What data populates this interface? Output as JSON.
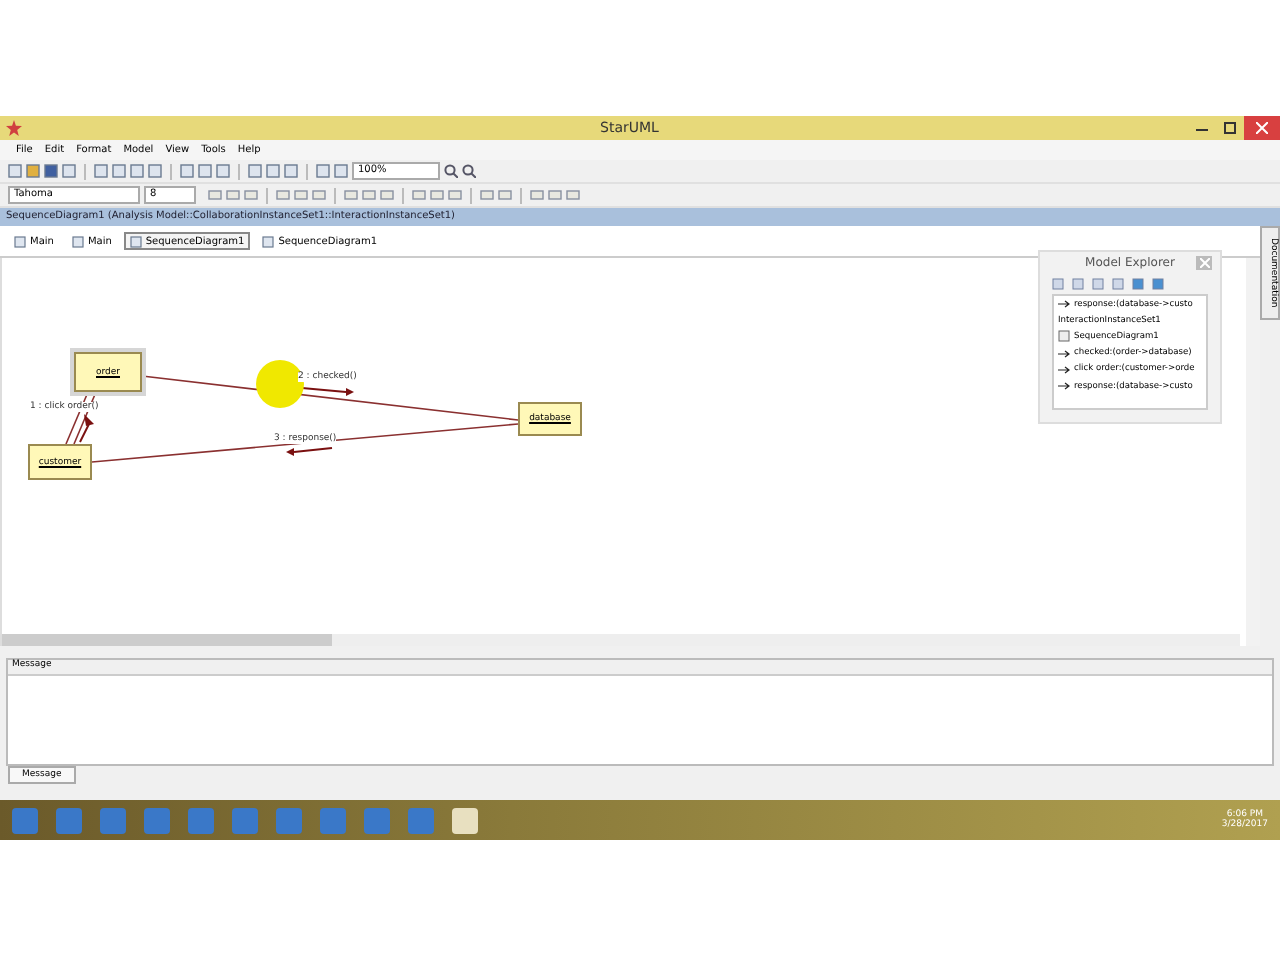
{
  "window": {
    "title": "StarUML"
  },
  "menu": [
    "File",
    "Edit",
    "Format",
    "Model",
    "View",
    "Tools",
    "Help"
  ],
  "toolbar": {
    "zoom": "100%",
    "font": "Tahoma",
    "font_size": "8"
  },
  "path_bar": "SequenceDiagram1 (Analysis Model::CollaborationInstanceSet1::InteractionInstanceSet1)",
  "tabs": [
    {
      "label": "Main",
      "selected": false
    },
    {
      "label": "Main",
      "selected": false
    },
    {
      "label": "SequenceDiagram1",
      "selected": true
    },
    {
      "label": "SequenceDiagram1",
      "selected": false
    }
  ],
  "diagram": {
    "objects": [
      {
        "name": "order",
        "selected": true
      },
      {
        "name": "customer",
        "selected": false
      },
      {
        "name": "database",
        "selected": false
      }
    ],
    "messages": [
      "1 : click order()",
      "2 : checked()",
      "3 : response()"
    ]
  },
  "model_explorer": {
    "title": "Model Explorer",
    "items": [
      {
        "kind": "message",
        "label": "response:(database->custo"
      },
      {
        "kind": "plain",
        "label": "InteractionInstanceSet1"
      },
      {
        "kind": "diagram",
        "label": "SequenceDiagram1"
      },
      {
        "kind": "message",
        "label": "checked:(order->database)"
      },
      {
        "kind": "message",
        "label": "click order:(customer->orde"
      },
      {
        "kind": "message",
        "label": "response:(database->custo"
      }
    ]
  },
  "side_tab": "Documentation",
  "message_panel": {
    "title": "Message",
    "tab": "Message"
  },
  "taskbar": {
    "time": "6:06 PM",
    "date": "3/28/2017"
  }
}
